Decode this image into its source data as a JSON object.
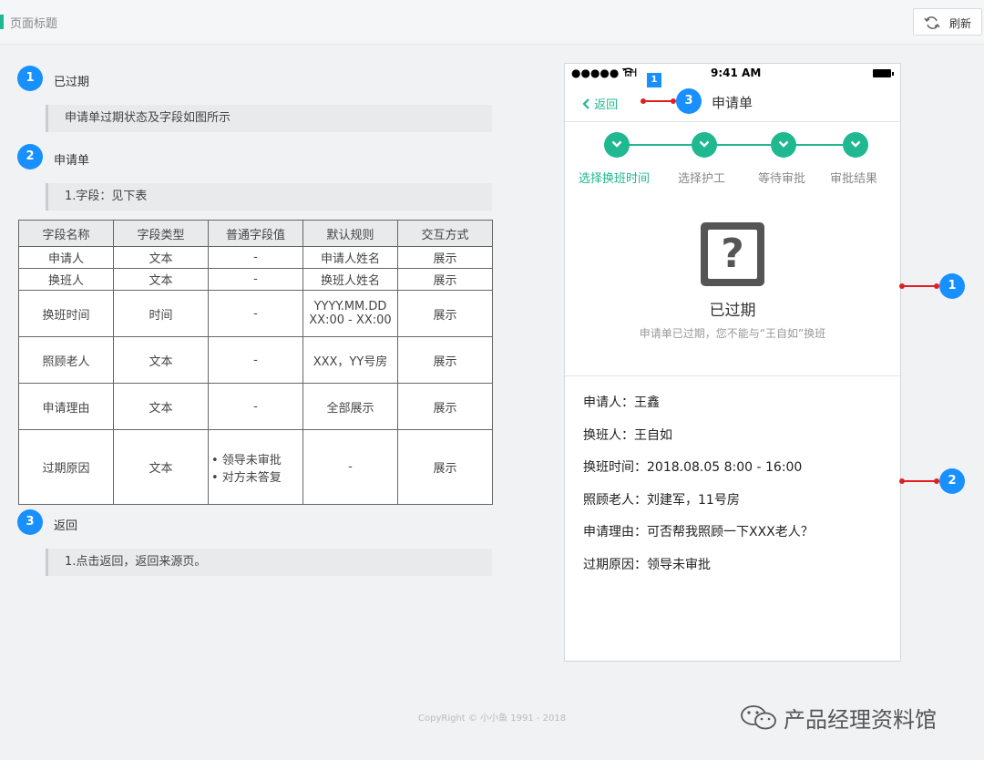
{
  "header": {
    "title": "页面标题",
    "refresh_label": "刷新"
  },
  "spec": {
    "sections": [
      {
        "num": "1",
        "title": "已过期",
        "note": "申请单过期状态及字段如图所示"
      },
      {
        "num": "2",
        "title": "申请单",
        "note": "1.字段：见下表"
      },
      {
        "num": "3",
        "title": "返回",
        "note": "1.点击返回，返回来源页。"
      }
    ],
    "table": {
      "headers": [
        "字段名称",
        "字段类型",
        "普通字段值",
        "默认规则",
        "交互方式"
      ],
      "rows": [
        [
          "申请人",
          "文本",
          "-",
          "申请人姓名",
          "展示"
        ],
        [
          "换班人",
          "文本",
          "-",
          "换班人姓名",
          "展示"
        ],
        [
          "换班时间",
          "时间",
          "-",
          "YYYY.MM.DD",
          "展示"
        ],
        [
          "照顾老人",
          "文本",
          "-",
          "XXX，YY号房",
          "展示"
        ],
        [
          "申请理由",
          "文本",
          "-",
          "全部展示",
          "展示"
        ],
        [
          "过期原因",
          "文本",
          "• 领导未审批",
          "-",
          "展示"
        ]
      ],
      "extra": {
        "time_rule_line2": "XX:00 - XX:00",
        "reason_value_line2": "• 对方未答复"
      }
    }
  },
  "phone": {
    "status": {
      "carrier": "●●●●● TH",
      "time": "9:41 AM"
    },
    "back_label": "返回",
    "nav_title": "申请单",
    "steps": [
      "选择换班时间",
      "选择护工",
      "等待审批",
      "审批结果"
    ],
    "state_title": "已过期",
    "state_desc": "申请单已过期，您不能与“王自如”换班",
    "fields": [
      "申请人：王鑫",
      "换班人：王自如",
      "换班时间：2018.08.05  8:00 - 16:00",
      "照顾老人：刘建军，11号房",
      "申请理由：可否帮我照顾一下XXX老人？",
      "过期原因：领导未审批"
    ]
  },
  "callouts": {
    "c1": "1",
    "c2": "2",
    "c3": "3",
    "tag": "1"
  },
  "footer": {
    "copyright": "CopyRight © 小小鱼 1991 - 2018",
    "watermark": "产品经理资料馆"
  },
  "colors": {
    "accent": "#1fb890",
    "badge": "#1890ff",
    "callout_line": "#e02020"
  }
}
